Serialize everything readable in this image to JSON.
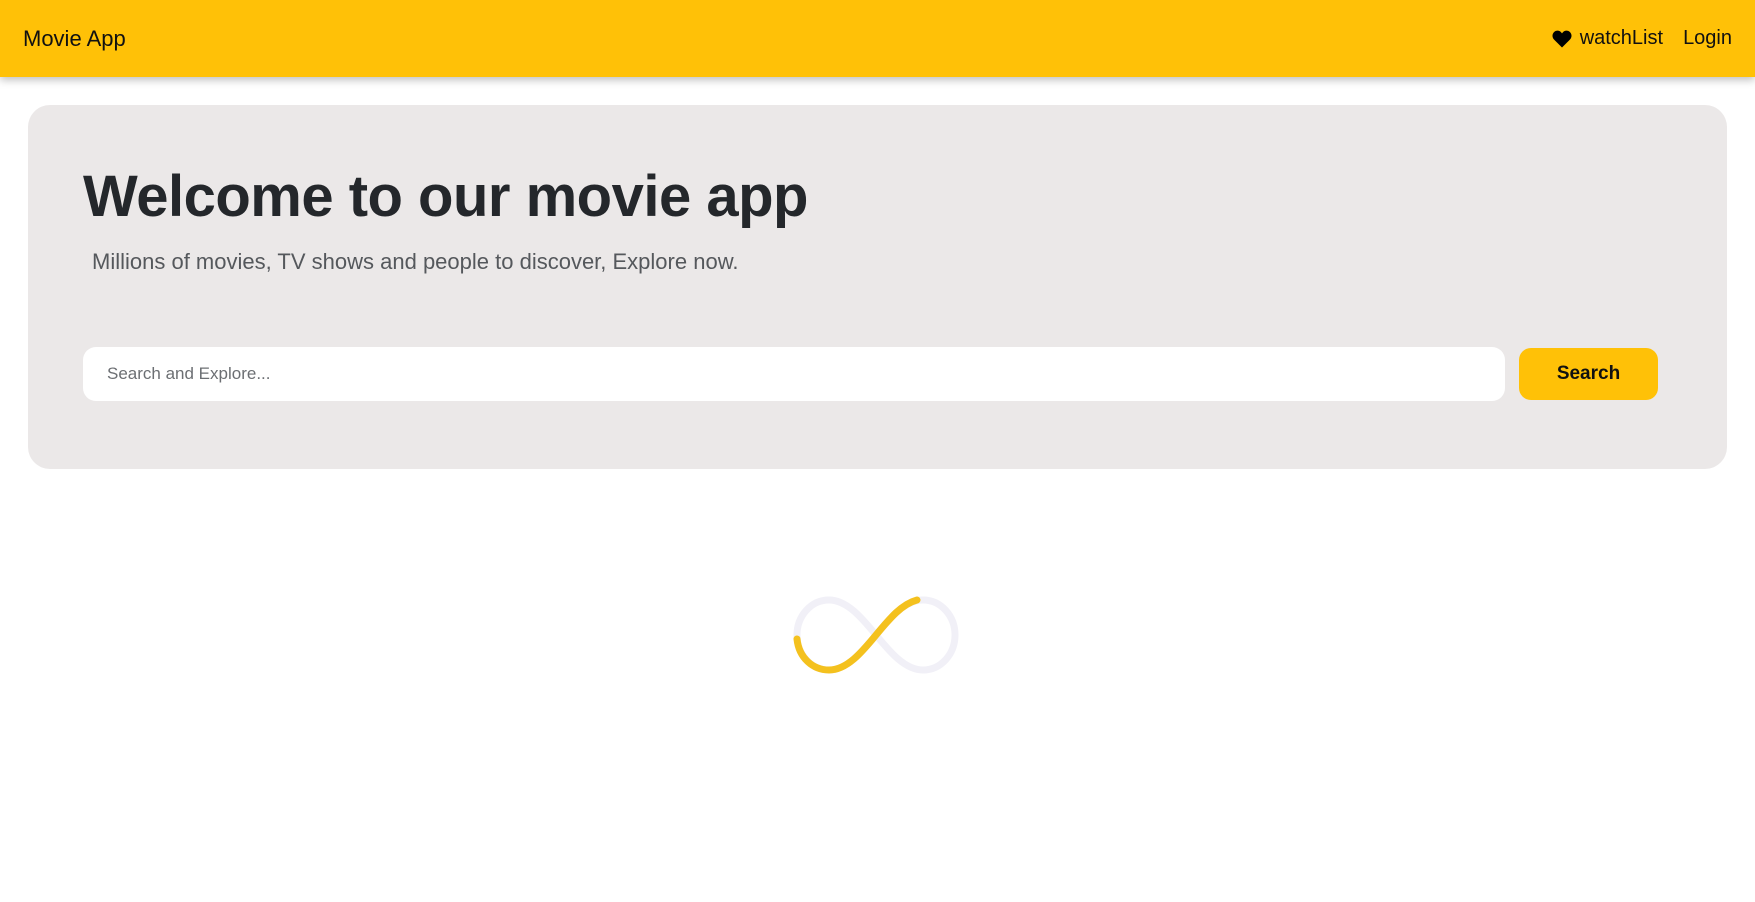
{
  "navbar": {
    "brand": "Movie App",
    "watchlist_label": "watchList",
    "login_label": "Login",
    "background_color": "#ffc107"
  },
  "hero": {
    "title": "Welcome to our movie app",
    "subtitle": "Millions of movies, TV shows and people to discover, Explore now.",
    "background_color": "#ebe8e8"
  },
  "search": {
    "placeholder": "Search and Explore...",
    "value": "",
    "button_label": "Search"
  },
  "loader": {
    "icon": "infinity-spinner-icon",
    "accent_color": "#f4c11e",
    "track_color": "#f1f0f7"
  },
  "icons": {
    "watchlist": "heart-icon"
  }
}
